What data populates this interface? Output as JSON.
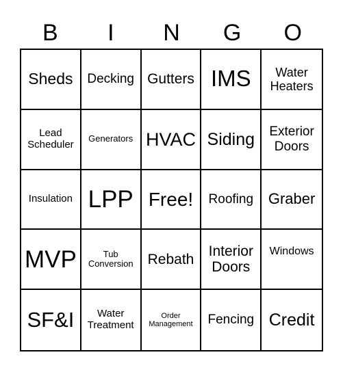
{
  "header": [
    "B",
    "I",
    "N",
    "G",
    "O"
  ],
  "cells": [
    [
      "Sheds",
      "Decking",
      "Gutters",
      "IMS",
      "Water\nHeaters"
    ],
    [
      "Lead\nScheduler",
      "Generators",
      "HVAC",
      "Siding",
      "Exterior\nDoors"
    ],
    [
      "Insulation",
      "LPP",
      "Free!",
      "Roofing",
      "Graber"
    ],
    [
      "MVP",
      "Tub\nConversion",
      "Rebath",
      "Interior\nDoors",
      "Windows"
    ],
    [
      "SF&I",
      "Water\nTreatment",
      "Order\nManagement",
      "Fencing",
      "Credit"
    ]
  ],
  "colors": {
    "text": "#000000",
    "border": "#000000",
    "background": "#ffffff"
  }
}
